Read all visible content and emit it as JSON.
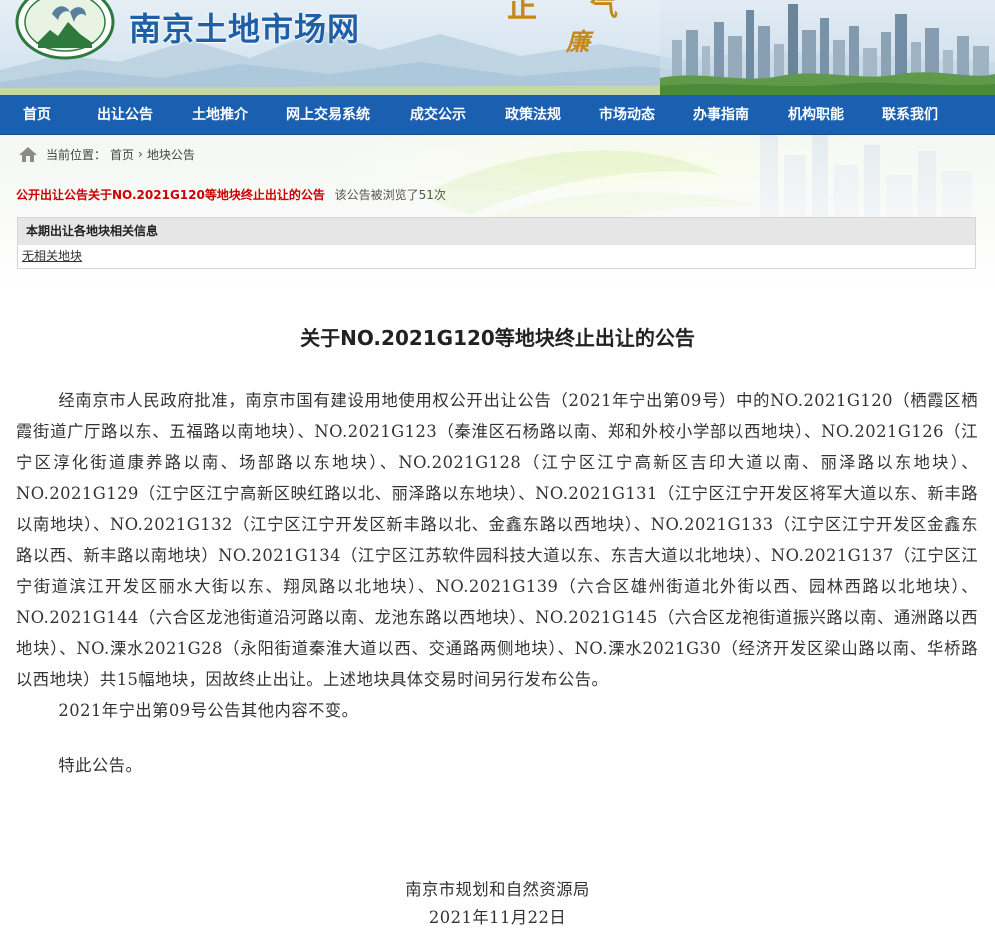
{
  "header": {
    "site_name": "南京土地市场网",
    "slogan_chars": [
      "正",
      "气",
      "廉"
    ],
    "colors": {
      "title": "#1f5fa6",
      "nav": "#1a5fb0",
      "notice": "#cc0000"
    }
  },
  "nav": {
    "items": [
      "首页",
      "出让公告",
      "土地推介",
      "网上交易系统",
      "成交公示",
      "政策法规",
      "市场动态",
      "办事指南",
      "机构职能",
      "联系我们"
    ]
  },
  "breadcrumb": {
    "icon": "home-icon",
    "label": "当前位置：",
    "home": "首页",
    "separator": "›",
    "current": "地块公告"
  },
  "notice": {
    "title": "公开出让公告关于NO.2021G120等地块终止出让的公告",
    "views": "该公告被浏览了51次"
  },
  "related": {
    "header": "本期出让各地块相关信息",
    "link": "无相关地块"
  },
  "article": {
    "title": "关于NO.2021G120等地块终止出让的公告",
    "paragraphs": [
      "经南京市人民政府批准，南京市国有建设用地使用权公开出让公告（2021年宁出第09号）中的NO.2021G120（栖霞区栖霞街道广厅路以东、五福路以南地块）、NO.2021G123（秦淮区石杨路以南、郑和外校小学部以西地块）、NO.2021G126（江宁区淳化街道康养路以南、场部路以东地块）、NO.2021G128（江宁区江宁高新区吉印大道以南、丽泽路以东地块）、NO.2021G129（江宁区江宁高新区映红路以北、丽泽路以东地块）、NO.2021G131（江宁区江宁开发区将军大道以东、新丰路以南地块）、NO.2021G132（江宁区江宁开发区新丰路以北、金鑫东路以西地块）、NO.2021G133（江宁区江宁开发区金鑫东路以西、新丰路以南地块）NO.2021G134（江宁区江苏软件园科技大道以东、东吉大道以北地块）、NO.2021G137（江宁区江宁街道滨江开发区丽水大街以东、翔凤路以北地块）、NO.2021G139（六合区雄州街道北外街以西、园林西路以北地块）、NO.2021G144（六合区龙池街道沿河路以南、龙池东路以西地块）、NO.2021G145（六合区龙袍街道振兴路以南、通洲路以西地块）、NO.溧水2021G28（永阳街道秦淮大道以西、交通路两侧地块）、NO.溧水2021G30（经济开发区梁山路以南、华桥路以西地块）共15幅地块，因故终止出让。上述地块具体交易时间另行发布公告。",
      "2021年宁出第09号公告其他内容不变。",
      "特此公告。"
    ],
    "signature": "南京市规划和自然资源局",
    "date": "2021年11月22日"
  }
}
